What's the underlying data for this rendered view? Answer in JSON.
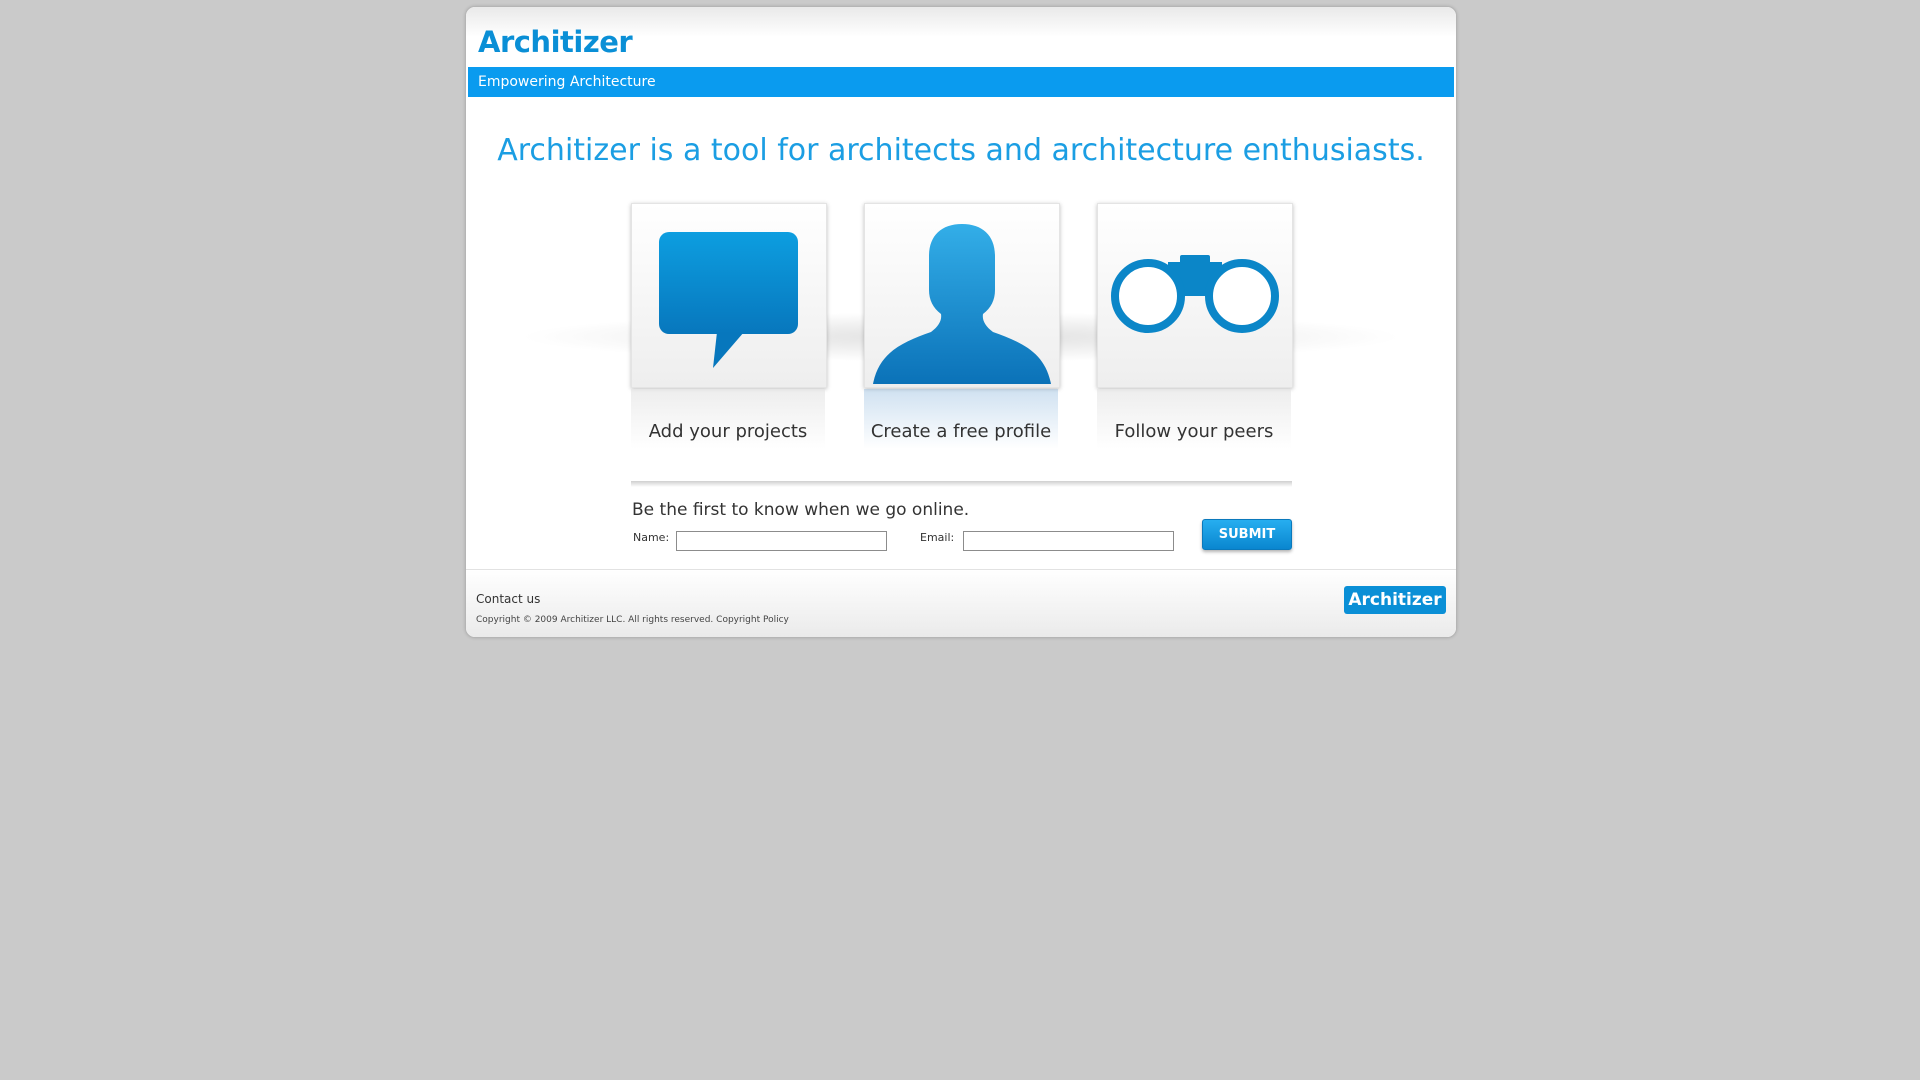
{
  "header": {
    "logo_text": "Architizer",
    "bar_text": "Empowering Architecture"
  },
  "main": {
    "tagline": "Architizer is a tool for architects and architecture enthusiasts.",
    "features": [
      {
        "label": "Add your projects",
        "icon": "speech-bubble-icon"
      },
      {
        "label": "Create a free profile",
        "icon": "person-silhouette-icon"
      },
      {
        "label": "Follow your peers",
        "icon": "binoculars-icon"
      }
    ],
    "signup": {
      "heading": "Be the first to know when we go online.",
      "name_label": "Name:",
      "name_value": "",
      "email_label": "Email:",
      "email_value": "",
      "submit_label": "SUBMIT"
    }
  },
  "footer": {
    "contact_label": "Contact us",
    "copyright_text": "Copyright © 2009 Architizer LLC. All rights reserved.",
    "policy_label": "Copyright Policy",
    "logo_text": "Architizer"
  },
  "colors": {
    "brand_blue": "#0a9bef",
    "page_background": "#cacaca"
  }
}
